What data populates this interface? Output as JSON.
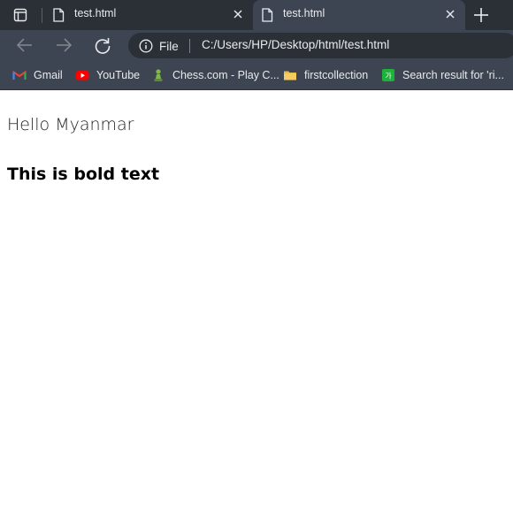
{
  "browser": {
    "tabs": [
      {
        "title": "test.html",
        "active": false
      },
      {
        "title": "test.html",
        "active": true
      }
    ],
    "address_bar": {
      "site_info_label": "File",
      "url": "C:/Users/HP/Desktop/html/test.html"
    },
    "bookmarks": [
      {
        "label": "Gmail",
        "icon": "gmail-icon"
      },
      {
        "label": "YouTube",
        "icon": "youtube-icon"
      },
      {
        "label": "Chess.com - Play C...",
        "icon": "chess-pawn-icon"
      },
      {
        "label": "firstcollection",
        "icon": "folder-icon"
      },
      {
        "label": "Search result for 'ri...",
        "icon": "dictionary-icon"
      }
    ],
    "colors": {
      "tabstrip": "#2b3036",
      "toolbar": "#3d4552",
      "omnibox": "#2b3036",
      "text": "#e8eaed"
    }
  },
  "page": {
    "paragraph": "Hello Myanmar",
    "bold_heading": "This is bold text"
  }
}
